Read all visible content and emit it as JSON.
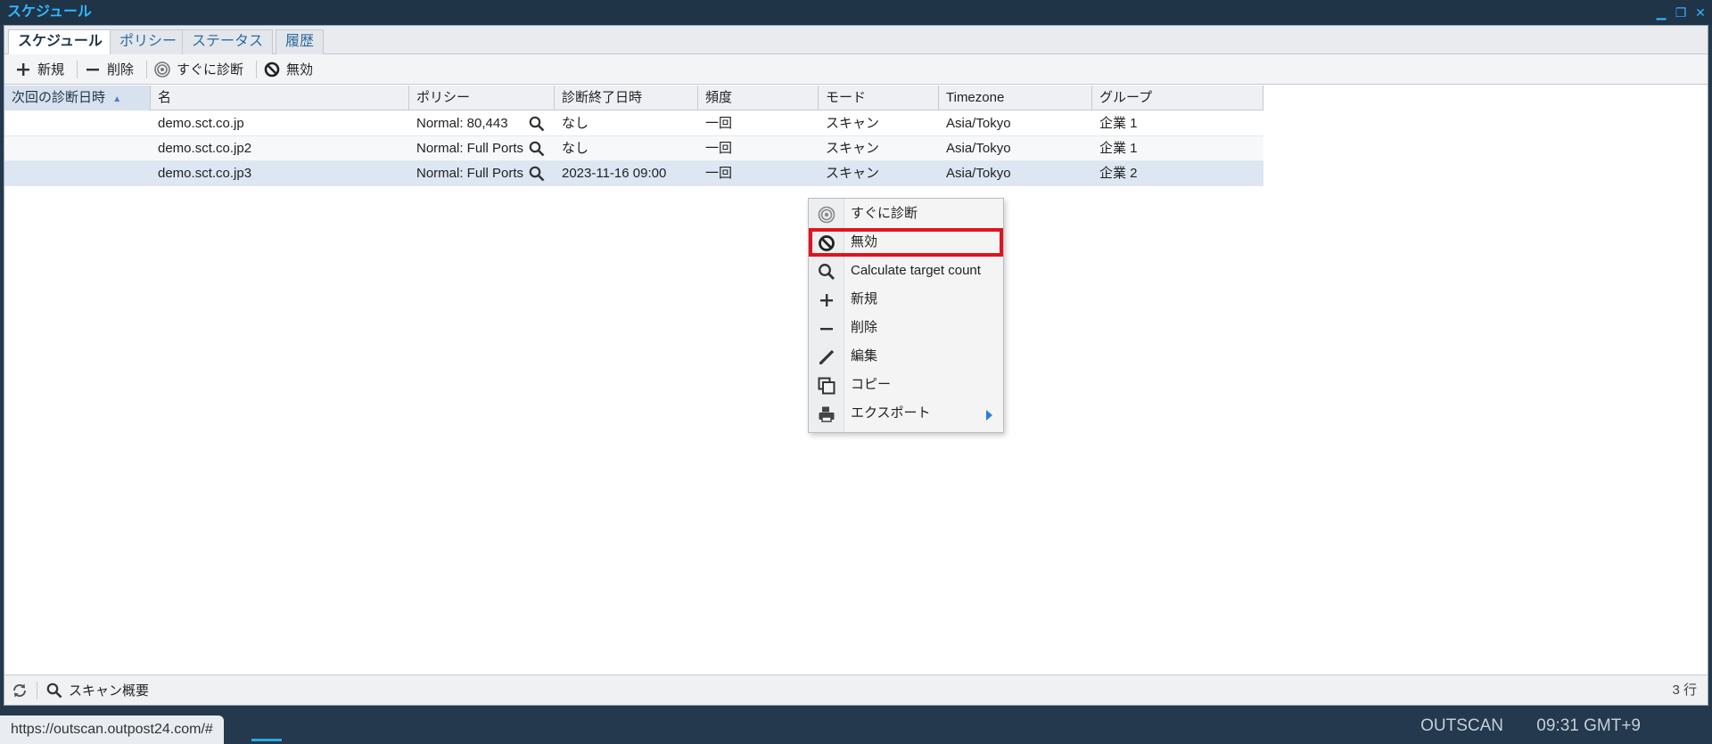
{
  "window": {
    "title": "スケジュール"
  },
  "tabs": [
    {
      "label": "スケジュール",
      "active": true
    },
    {
      "label": "ポリシー"
    },
    {
      "label": "ステータス"
    },
    {
      "label": "履歴"
    }
  ],
  "toolbar": {
    "new_label": "新規",
    "delete_label": "削除",
    "scan_now_label": "すぐに診断",
    "disable_label": "無効"
  },
  "table": {
    "columns": [
      "次回の診断日時",
      "名",
      "ポリシー",
      "診断終了日時",
      "頻度",
      "モード",
      "Timezone",
      "グループ"
    ],
    "rows": [
      {
        "next": "",
        "name": "demo.sct.co.jp",
        "policy": "Normal: 80,443",
        "end": "なし",
        "freq": "一回",
        "mode": "スキャン",
        "tz": "Asia/Tokyo",
        "group": "企業 1"
      },
      {
        "next": "",
        "name": "demo.sct.co.jp2",
        "policy": "Normal: Full Ports",
        "end": "なし",
        "freq": "一回",
        "mode": "スキャン",
        "tz": "Asia/Tokyo",
        "group": "企業 1"
      },
      {
        "next": "",
        "name": "demo.sct.co.jp3",
        "policy": "Normal: Full Ports",
        "end": "2023-11-16 09:00",
        "freq": "一回",
        "mode": "スキャン",
        "tz": "Asia/Tokyo",
        "group": "企業 2"
      }
    ]
  },
  "context_menu": {
    "items": [
      "すぐに診断",
      "無効",
      "Calculate target count",
      "新規",
      "削除",
      "編集",
      "コピー",
      "エクスポート"
    ],
    "highlighted": "無効"
  },
  "statusbar": {
    "summary_label": "スキャン概要",
    "row_count": "3 行"
  },
  "url_tooltip": "https://outscan.outpost24.com/#",
  "taskbar": {
    "brand": "OUTSCAN",
    "clock": "09:31 GMT+9"
  },
  "colors": {
    "accent": "#33b5ff",
    "highlight_border": "#e0141e",
    "selected_row": "#dde6f3"
  }
}
